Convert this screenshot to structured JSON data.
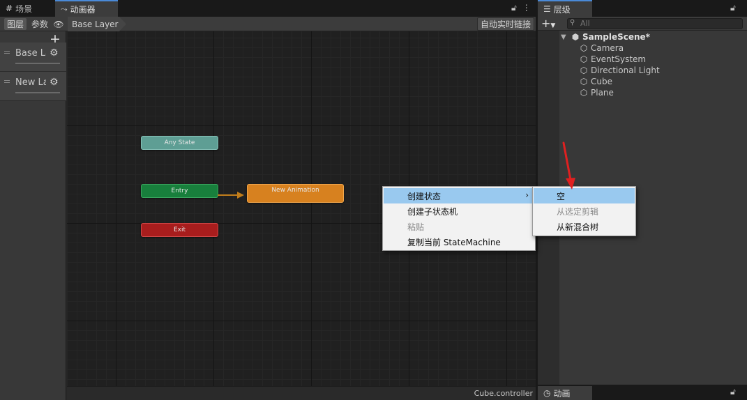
{
  "tabs": {
    "scene": {
      "label": "场景",
      "icon": "grid-icon"
    },
    "animator": {
      "label": "动画器",
      "icon": "animator-icon"
    }
  },
  "toolbar": {
    "layers_tab": "图层",
    "params_tab": "参数",
    "breadcrumb": "Base Layer",
    "live_link": "自动实时链接"
  },
  "layers": [
    {
      "name": "Base Layer"
    },
    {
      "name": "New Layer"
    }
  ],
  "nodes": {
    "any_state": "Any State",
    "entry": "Entry",
    "exit": "Exit",
    "new_animation": "New Animation"
  },
  "colors": {
    "any_state": "#5e9e94",
    "entry": "#187f3c",
    "exit": "#a81d1d",
    "new_animation": "#d7811f",
    "transition": "#c17d1b",
    "menu_highlight": "#99c9ef",
    "annotation_arrow": "#e02020"
  },
  "statusbar": {
    "file": "Cube.controller"
  },
  "hierarchy": {
    "tab_label": "层级",
    "search_placeholder": "All",
    "scene_name": "SampleScene*",
    "objects": [
      "Camera",
      "EventSystem",
      "Directional Light",
      "Cube",
      "Plane"
    ]
  },
  "bottom_tab": {
    "label": "动画"
  },
  "context_menu": {
    "items": [
      {
        "label": "创建状态",
        "submenu": true,
        "highlighted": true,
        "disabled": false
      },
      {
        "label": "创建子状态机",
        "submenu": false,
        "highlighted": false,
        "disabled": false
      },
      {
        "label": "粘贴",
        "submenu": false,
        "highlighted": false,
        "disabled": true
      },
      {
        "label": "复制当前 StateMachine",
        "submenu": false,
        "highlighted": false,
        "disabled": false
      }
    ]
  },
  "submenu": {
    "items": [
      {
        "label": "空",
        "highlighted": true,
        "disabled": false
      },
      {
        "label": "从选定剪辑",
        "highlighted": false,
        "disabled": true
      },
      {
        "label": "从新混合树",
        "highlighted": false,
        "disabled": false
      }
    ]
  }
}
